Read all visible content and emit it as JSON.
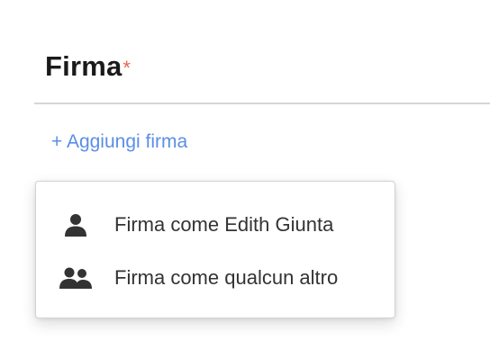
{
  "section": {
    "title": "Firma",
    "required_marker": "*"
  },
  "add_signature_link": "+ Aggiungi firma",
  "dropdown": {
    "items": [
      {
        "label": "Firma come Edith Giunta",
        "icon": "user-icon"
      },
      {
        "label": "Firma come qualcun altro",
        "icon": "users-icon"
      }
    ]
  },
  "colors": {
    "accent_link": "#5b8ee6",
    "required_star": "#e8674a",
    "icon": "#333333"
  }
}
